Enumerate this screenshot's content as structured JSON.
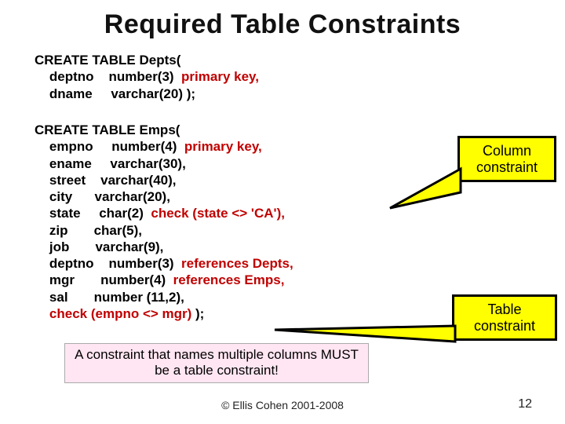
{
  "title": "Required Table Constraints",
  "depts": {
    "line0": "CREATE TABLE Depts(",
    "c1a": "deptno",
    "c1b": "number(3)",
    "c1c": "primary key,",
    "c2a": "dname",
    "c2b": "varchar(20) );"
  },
  "emps": {
    "line0": "CREATE TABLE Emps(",
    "r1a": "empno",
    "r1b": "number(4)",
    "r1c": "primary key,",
    "r2a": "ename",
    "r2b": "varchar(30),",
    "r3a": "street",
    "r3b": "varchar(40),",
    "r4a": "city",
    "r4b": "varchar(20),",
    "r5a": "state",
    "r5b": "char(2)",
    "r5c": "check (state <> 'CA'),",
    "r6a": "zip",
    "r6b": "char(5),",
    "r7a": "job",
    "r7b": "varchar(9),",
    "r8a": "deptno",
    "r8b": "number(3)",
    "r8c": "references Depts,",
    "r9a": "mgr",
    "r9b": "number(4)",
    "r9c": "references Emps,",
    "r10a": "sal",
    "r10b": "number (11,2),",
    "lastA": "check (empno <> mgr)",
    "lastB": " );"
  },
  "callout1": "Column\nconstraint",
  "callout2": "Table\nconstraint",
  "note": "A constraint that names multiple columns MUST be a table constraint!",
  "footer": "© Ellis Cohen 2001-2008",
  "pagenum": "12"
}
